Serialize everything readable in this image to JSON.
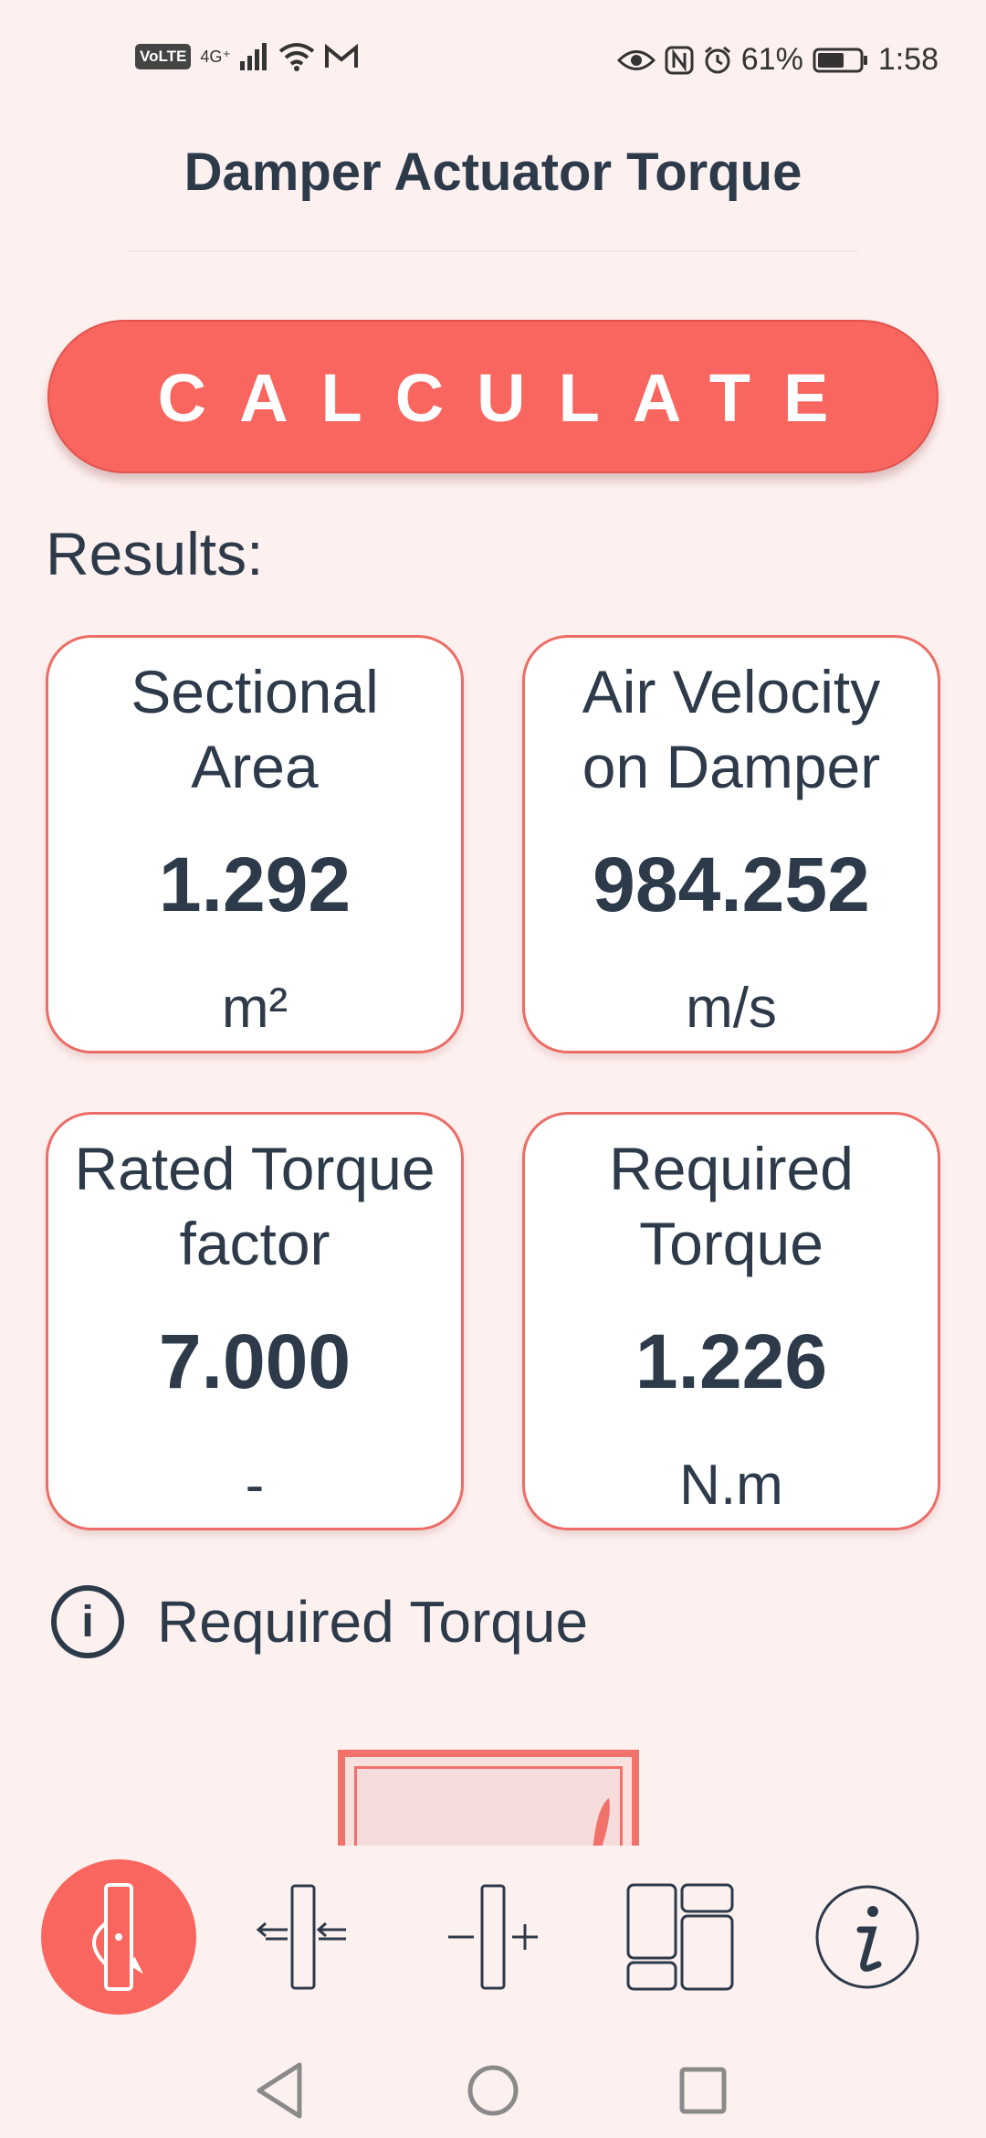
{
  "status_bar": {
    "volte": "VoLTE",
    "network": "4G⁺",
    "battery": "61%",
    "time": "1:58"
  },
  "header": {
    "title": "Damper Actuator Torque"
  },
  "calculate_button": {
    "label": "CALCULATE"
  },
  "results": {
    "label": "Results:",
    "cards": [
      {
        "label": "Sectional Area",
        "value": "1.292",
        "unit": "m²"
      },
      {
        "label": "Air Velocity on Damper",
        "value": "984.252",
        "unit": "m/s"
      },
      {
        "label": "Rated Torque factor",
        "value": "7.000",
        "unit": "-"
      },
      {
        "label": "Required Torque",
        "value": "1.226",
        "unit": "N.m"
      }
    ]
  },
  "info": {
    "icon": "i",
    "text": "Required Torque"
  },
  "bottom_nav": {
    "items": [
      {
        "name": "torque-icon",
        "active": true
      },
      {
        "name": "airflow-damper-icon",
        "active": false
      },
      {
        "name": "damper-plus-minus-icon",
        "active": false
      },
      {
        "name": "layout-icon",
        "active": false
      },
      {
        "name": "info-icon",
        "active": false
      }
    ]
  },
  "colors": {
    "accent": "#f8665f",
    "text": "#2d3a4a",
    "background": "#fdf1f0"
  }
}
